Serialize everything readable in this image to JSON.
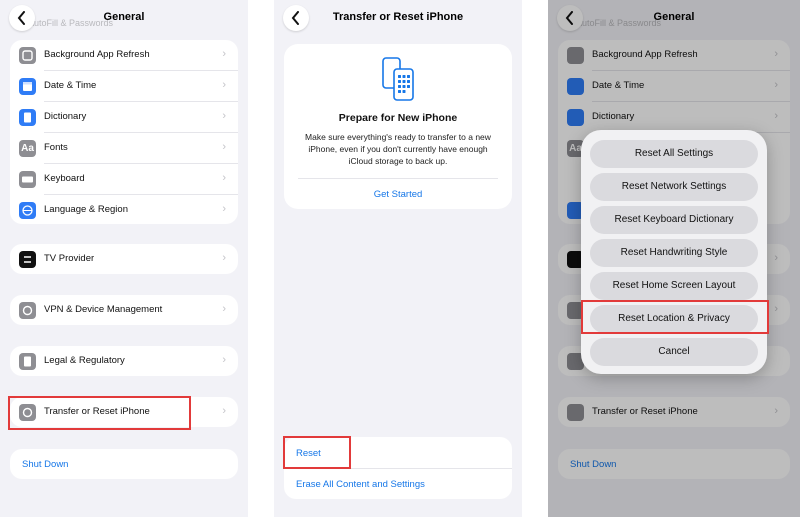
{
  "general": {
    "title": "General",
    "ghost_row": "AutoFill & Passwords",
    "rows": [
      {
        "label": "Background App Refresh",
        "icon": "app-refresh-icon",
        "color": "#8e8e93"
      },
      {
        "label": "Date & Time",
        "icon": "calendar-icon",
        "color": "#2f7cf6"
      },
      {
        "label": "Dictionary",
        "icon": "book-icon",
        "color": "#2f7cf6"
      },
      {
        "label": "Fonts",
        "icon": "fonts-icon",
        "color": "#8e8e93",
        "glyph": "Aa"
      },
      {
        "label": "Keyboard",
        "icon": "keyboard-icon",
        "color": "#8e8e93"
      },
      {
        "label": "Language & Region",
        "icon": "globe-icon",
        "color": "#2f7cf6"
      }
    ],
    "tv_provider": "TV Provider",
    "vpn": "VPN & Device Management",
    "legal": "Legal & Regulatory",
    "transfer": "Transfer or Reset iPhone",
    "shutdown": "Shut Down"
  },
  "transfer_screen": {
    "title": "Transfer or Reset iPhone",
    "card_title": "Prepare for New iPhone",
    "card_desc": "Make sure everything's ready to transfer to a new iPhone, even if you don't currently have enough iCloud storage to back up.",
    "get_started": "Get Started",
    "reset": "Reset",
    "erase": "Erase All Content and Settings"
  },
  "reset_sheet": {
    "options": [
      "Reset All Settings",
      "Reset Network Settings",
      "Reset Keyboard Dictionary",
      "Reset Handwriting Style",
      "Reset Home Screen Layout",
      "Reset Location & Privacy"
    ],
    "cancel": "Cancel"
  },
  "colors": {
    "accent": "#1677e8",
    "highlight": "#e23a3a",
    "background": "#f2f2f7"
  }
}
